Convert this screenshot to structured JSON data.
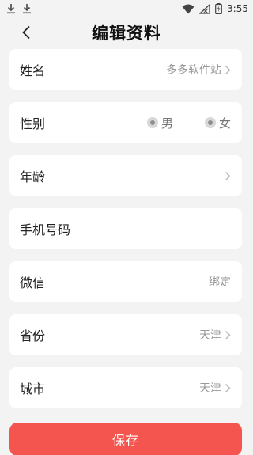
{
  "status_bar": {
    "time": "3:55",
    "icons": [
      "download-icon",
      "download-icon",
      "wifi-icon",
      "no-signal-icon",
      "battery-charging-icon"
    ]
  },
  "header": {
    "back_icon": "chevron-left-icon",
    "title": "编辑资料"
  },
  "form": {
    "name": {
      "label": "姓名",
      "value": "多多软件站"
    },
    "gender": {
      "label": "性别",
      "options": [
        "男",
        "女"
      ]
    },
    "age": {
      "label": "年龄",
      "value": ""
    },
    "phone": {
      "label": "手机号码",
      "value": ""
    },
    "wechat": {
      "label": "微信",
      "value": "绑定"
    },
    "province": {
      "label": "省份",
      "value": "天津"
    },
    "city": {
      "label": "城市",
      "value": "天津"
    }
  },
  "save_label": "保存",
  "colors": {
    "accent": "#f4554f",
    "background": "#f3f3f3",
    "card": "#ffffff",
    "muted_text": "#9a9a9a"
  }
}
